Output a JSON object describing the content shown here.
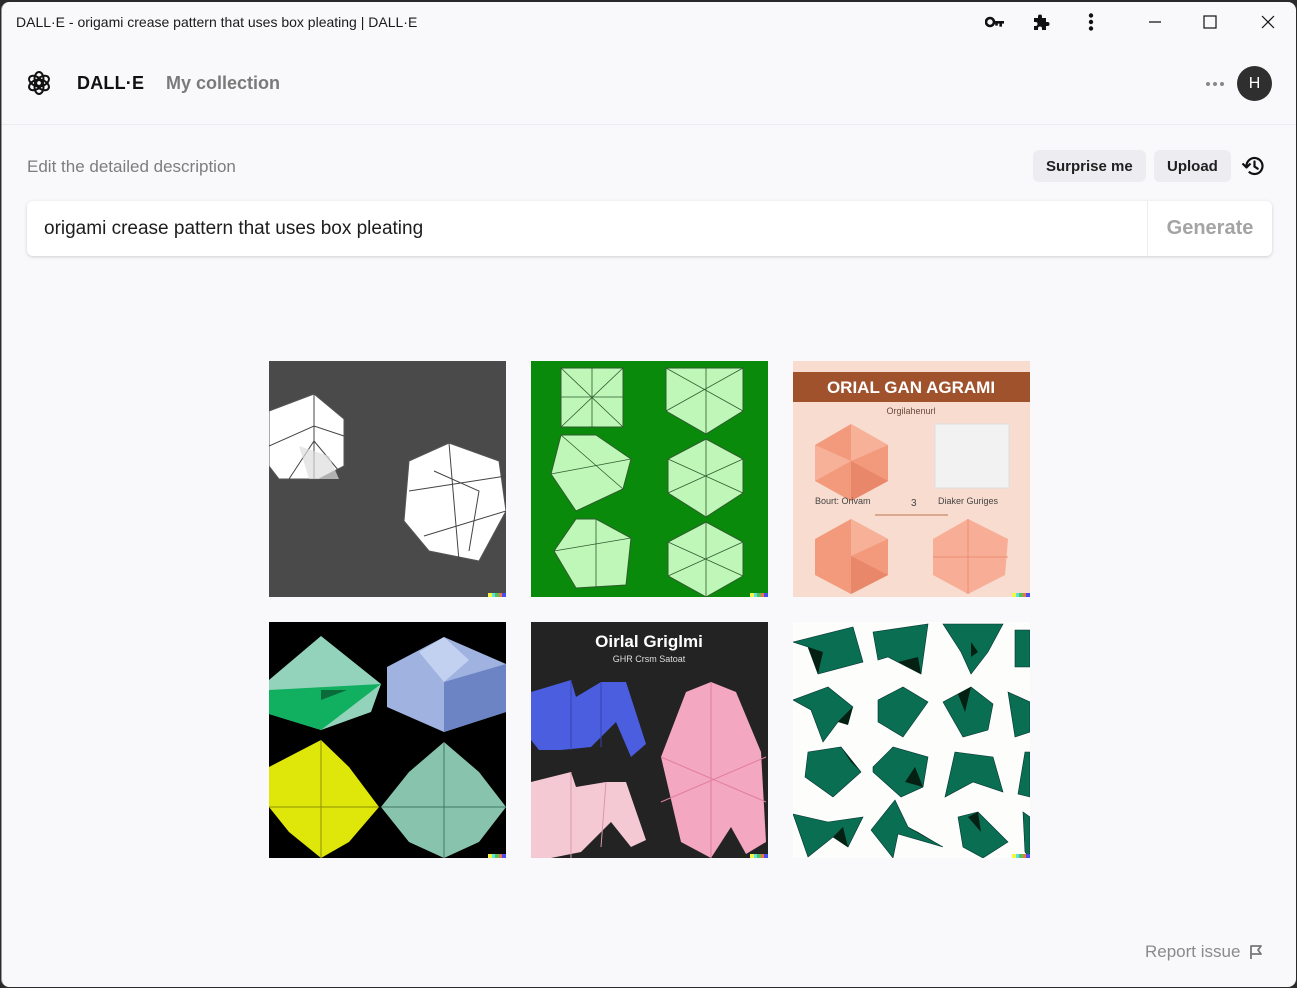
{
  "window": {
    "title": "DALL·E - origami crease pattern that uses box pleating | DALL·E",
    "controls": [
      "key-icon",
      "puzzle-extension-icon",
      "kebab-menu-icon",
      "minimize-icon",
      "maximize-icon",
      "close-icon"
    ]
  },
  "header": {
    "brand": "DALL·E",
    "nav": {
      "my_collection": "My collection"
    },
    "avatar_initial": "H"
  },
  "prompt": {
    "label": "Edit the detailed description",
    "surprise_label": "Surprise me",
    "upload_label": "Upload",
    "value": "origami crease pattern that uses box pleating",
    "generate_label": "Generate"
  },
  "results": {
    "images": [
      {
        "description": "White crease-pattern origami shapes on dark gray background",
        "background": "#4a4a4a"
      },
      {
        "description": "Light green folded polygons with crease lines on green background",
        "background": "#0a8a0a"
      },
      {
        "description": "Salmon origami hexagons poster with brown header",
        "background": "#f8dccf",
        "header_text": "ORIAL GAN    AGRAMI",
        "subtitle": "Orgilahenurl",
        "caption_left": "Bourt: Orivam",
        "caption_number": "3",
        "caption_right": "Diaker Guriges"
      },
      {
        "description": "Green, blue, yellow and mint 3D origami forms on black background",
        "background": "#000000"
      },
      {
        "description": "Blue and pink pleated paper origami on dark background",
        "background": "#222222",
        "header_text": "Oirlal Griglmi",
        "subtitle": "GHR Crsm Satoat"
      },
      {
        "description": "Dark green folded star shapes scattered on white background",
        "background": "#fdfdfb"
      }
    ],
    "signature_colors": [
      "#f5f542",
      "#5ce1e6",
      "#52c452",
      "#f2704f",
      "#4a4fe8"
    ]
  },
  "footer": {
    "report_label": "Report issue"
  }
}
